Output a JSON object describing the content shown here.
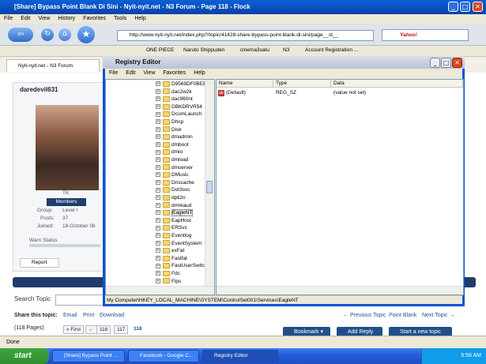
{
  "browser": {
    "title": "[Share] Bypass Point Blank Di Sini - Nyit-nyit.net - N3 Forum - Page 118 - Flock",
    "menu": [
      "File",
      "Edit",
      "View",
      "History",
      "Favorites",
      "Tools",
      "Help"
    ],
    "url": "http://www.nyit-nyit.net/index.php?/topic/41428-share-bypass-point-blank-di-sini/page__st__",
    "search_placeholder": "Yahoo!",
    "bookmarks": [
      "ONE PIECE",
      "Naruto Shippuden",
      "cinema3satu",
      "N3",
      "Account Registration ..."
    ],
    "tab": "Nyit-nyit.net - N3 Forum",
    "status": "Done"
  },
  "forum": {
    "username": "daredevil631",
    "rank": "TK",
    "member_badge": "Members",
    "group_label": "Group:",
    "group_value": "Level I",
    "posts_label": "Posts:",
    "posts_value": "37",
    "joined_label": "Joined:",
    "joined_value": "18-October 08",
    "warn_label": "Warn Status",
    "report_label": "Report",
    "search_label": "Search Topic",
    "share_label": "Share this topic:",
    "share_links": [
      "Email",
      "Print",
      "Download"
    ],
    "nav_prev": "← Previous Topic",
    "nav_category": "Point Blank",
    "nav_next": "Next Topic →",
    "pages_label": "(118 Pages)",
    "pager": [
      "« First",
      "←",
      "116",
      "117",
      "118"
    ],
    "btn_bookmark": "Bookmark ▾",
    "btn_reply": "Add Reply",
    "btn_new_topic": "Start a new topic"
  },
  "regedit": {
    "title": "Registry Editor",
    "menu": [
      "File",
      "Edit",
      "View",
      "Favorites",
      "Help"
    ],
    "tree": [
      "D9569DF0BEEF",
      "dac2w2k",
      "dac960nt",
      "DBKDRVR54",
      "DcomLaunch",
      "Dhcp",
      "Disk",
      "dmadmin",
      "dmboot",
      "dmio",
      "dmload",
      "dmserver",
      "DMusic",
      "Dnscache",
      "Dot3svc",
      "dpti2o",
      "drmkaud",
      "EagleNT",
      "EapHost",
      "ERSvc",
      "Eventlog",
      "EventSystem",
      "exFat",
      "Fastfat",
      "FastUserSwitc",
      "Fdc",
      "Fips"
    ],
    "selected": "EagleNT",
    "columns": [
      "Name",
      "Type",
      "Data"
    ],
    "rows": [
      {
        "name": "(Default)",
        "type": "REG_SZ",
        "data": "(value not set)"
      }
    ],
    "status": "My Computer\\HKEY_LOCAL_MACHINE\\SYSTEM\\ControlSet001\\Services\\EagleNT"
  },
  "taskbar": {
    "start": "start",
    "tasks": [
      "[Share] Bypass Point ...",
      "Facebook - Google C...",
      "Registry Editor"
    ],
    "clock": "5:58 AM"
  }
}
